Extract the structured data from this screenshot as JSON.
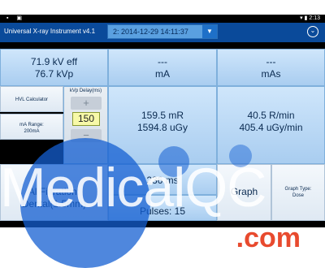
{
  "status": {
    "left": "▪ ▣",
    "right": "▾ ▮ 2:13"
  },
  "app": {
    "title": "Universal X-ray Instrument v4.1",
    "overflow_icon": "⌄"
  },
  "dropdown": {
    "value": "2: 2014-12-29 14:11:37",
    "arrow": "▼"
  },
  "tiles": {
    "kv": {
      "line1": "71.9 kV eff",
      "line2": "76.7 kVp"
    },
    "ma": {
      "line1": "---",
      "line2": "mA"
    },
    "mas": {
      "line1": "---",
      "line2": "mAs"
    },
    "hvl": {
      "label": "HVL Calculator"
    },
    "ma_range": {
      "line1": "mA Range:",
      "line2": "200mA"
    },
    "delay": {
      "label": "kVp Delay(ms)",
      "plus": "+",
      "value": "150",
      "minus": "−"
    },
    "dose": {
      "line1": "159.5 mR",
      "line2": "1594.8 uGy"
    },
    "rate": {
      "line1": "40.5 R/min",
      "line2": "405.4 uGy/min"
    },
    "filter": {
      "line1": "Al Filtration:",
      "line2": "Dental(1.5mm)"
    },
    "time": {
      "value": "236 ms"
    },
    "pulses": {
      "value": "Pulses: 15"
    },
    "graph": {
      "label": "Graph"
    },
    "graph_type": {
      "line1": "Graph Type:",
      "line2": "Dose"
    }
  },
  "watermark": {
    "main": "MedicalQC",
    "suffix": ".com"
  },
  "colors": {
    "header": "#0a4a9a",
    "tile": "#bcdaf6",
    "brand_blue": "#145fd2",
    "brand_red": "#e84a2e"
  }
}
